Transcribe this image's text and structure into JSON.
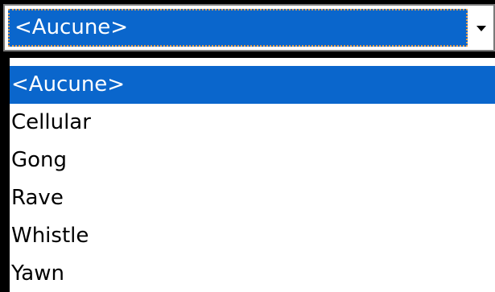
{
  "combobox": {
    "selected_value": "<Aucune>",
    "arrow_icon": "dropdown-arrow-icon"
  },
  "dropdown": {
    "items": [
      {
        "label": "<Aucune>",
        "selected": true
      },
      {
        "label": "Cellular",
        "selected": false
      },
      {
        "label": "Gong",
        "selected": false
      },
      {
        "label": "Rave",
        "selected": false
      },
      {
        "label": "Whistle",
        "selected": false
      },
      {
        "label": "Yawn",
        "selected": false
      }
    ]
  },
  "colors": {
    "selection": "#0a66cc",
    "focus_outline": "#e8a04a",
    "background": "#000000",
    "list_background": "#ffffff"
  }
}
